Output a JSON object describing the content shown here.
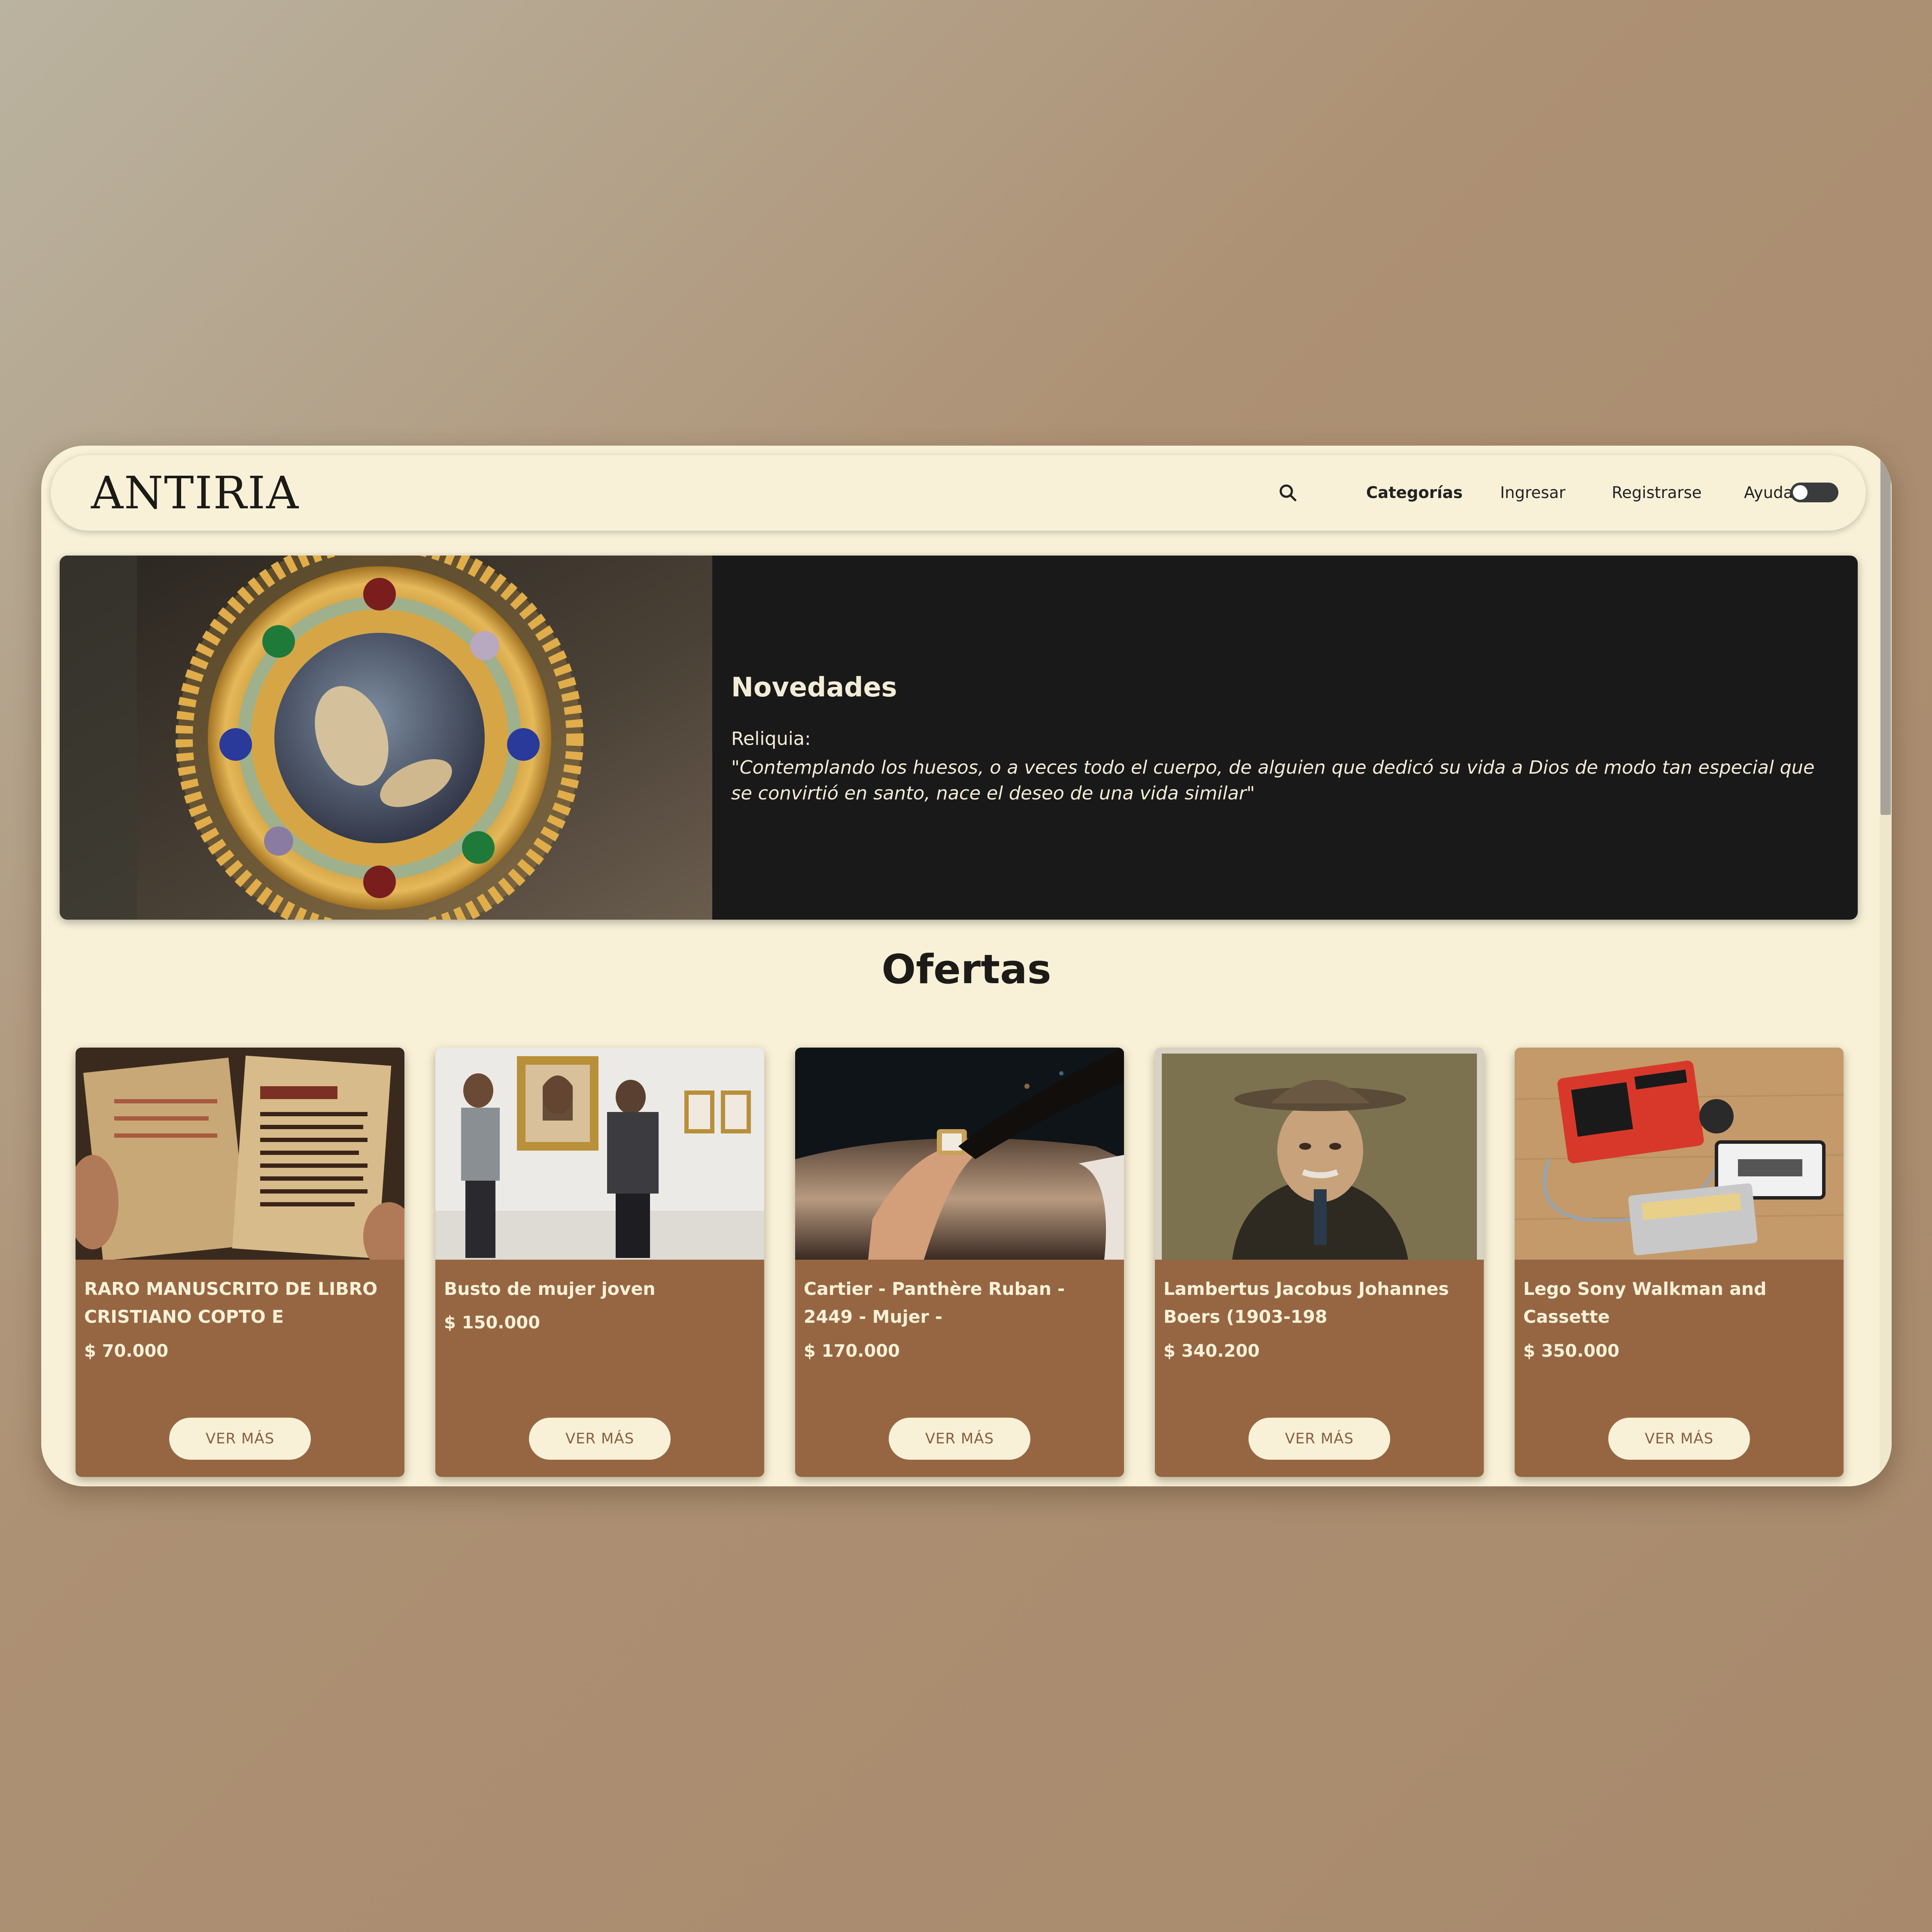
{
  "brand": {
    "logo": "ANTIRIA"
  },
  "nav": {
    "search_icon": "search-icon",
    "items": [
      {
        "label": "Categorías"
      },
      {
        "label": "Ingresar"
      },
      {
        "label": "Registrarse"
      },
      {
        "label": "Ayuda"
      }
    ],
    "theme_toggle": {
      "state": "off"
    }
  },
  "hero": {
    "title": "Novedades",
    "label": "Reliquia:",
    "quote": "\"Contemplando los huesos, o a veces todo el cuerpo, de alguien que dedicó su vida a Dios de modo tan especial que se convirtió en santo, nace el deseo de una vida similar\""
  },
  "offers": {
    "title": "Ofertas",
    "button_label": "VER MÁS",
    "items": [
      {
        "title": "RARO MANUSCRITO DE LIBRO CRISTIANO COPTO E",
        "price": "$ 70.000"
      },
      {
        "title": "Busto de mujer joven",
        "price": "$ 150.000"
      },
      {
        "title": "Cartier - Panthère Ruban - 2449 - Mujer -",
        "price": "$ 170.000"
      },
      {
        "title": "Lambertus Jacobus Johannes Boers (1903-198",
        "price": "$ 340.200"
      },
      {
        "title": "Lego Sony Walkman and Cassette",
        "price": "$ 350.000"
      }
    ]
  },
  "colors": {
    "page_bg": "#f8f1d8",
    "card_bg": "#966642",
    "hero_bg": "#191919",
    "text_dark": "#1d1b18"
  }
}
